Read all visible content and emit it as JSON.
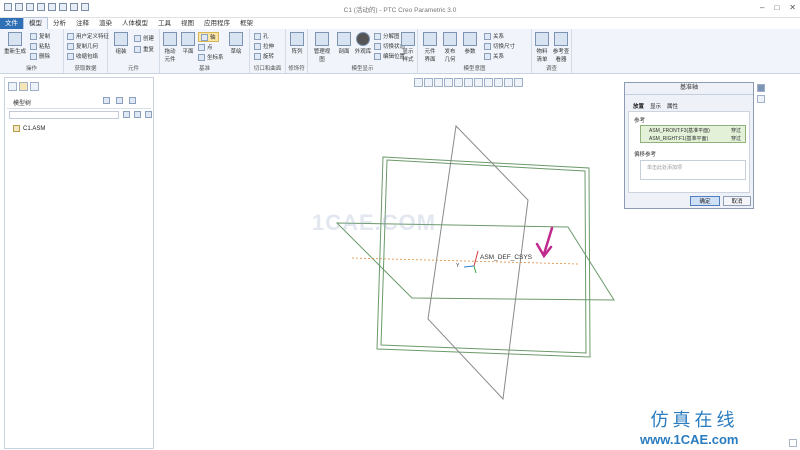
{
  "window": {
    "title": "C1 (活动的) - PTC Creo Parametric 3.0"
  },
  "ribbon_tabs": [
    "文件",
    "模型",
    "分析",
    "注释",
    "渲染",
    "人体模型",
    "工具",
    "视图",
    "应用程序",
    "框架"
  ],
  "active_tab": "模型",
  "ribbon": {
    "operations": {
      "items": [
        "重新生成",
        "复制",
        "粘贴",
        "删除"
      ],
      "label": "操作"
    },
    "get_data": {
      "items": [
        "用户定义特征",
        "复制几何",
        "收缩包络"
      ],
      "label": "获取数据"
    },
    "components": {
      "items": [
        "组装",
        "创建",
        "重复"
      ],
      "label": "元件"
    },
    "datum": {
      "items": [
        "拖动元件",
        "平面",
        "轴",
        "点",
        "坐标系",
        "草绘"
      ],
      "label": "基准"
    },
    "cut_surface": {
      "items": [
        "孔",
        "拉伸",
        "旋转"
      ],
      "label": "切口和曲面"
    },
    "modifiers": {
      "items": [
        "阵列"
      ],
      "label": "修饰符"
    },
    "model_display": {
      "items": [
        "管理视图",
        "剖面",
        "外观库",
        "分解图",
        "切换状态",
        "编辑位置",
        "显示样式"
      ],
      "label": "模型显示"
    },
    "model_intent": {
      "items": [
        "元件界面",
        "发布几何",
        "参数",
        "关系",
        "切换尺寸",
        "关系"
      ],
      "label": "模型意图"
    },
    "investigate": {
      "items": [
        "物料清单",
        "参考查看器"
      ],
      "label": "调查"
    }
  },
  "model_tree": {
    "title": "模型树",
    "items": [
      {
        "label": "C1.ASM",
        "icon": "assembly-icon"
      }
    ]
  },
  "viewport": {
    "coord_sys_label": "ASM_DEF_CSYS",
    "watermark": "1CAE.COM"
  },
  "dialog": {
    "title": "基准轴",
    "tabs": [
      "放置",
      "显示",
      "属性"
    ],
    "active_tab": "放置",
    "references_label": "参考",
    "references": [
      {
        "name": "ASM_FRONT:F3(基准平面)",
        "constraint": "穿过"
      },
      {
        "name": "ASM_RIGHT:F1(基准平面)",
        "constraint": "穿过"
      }
    ],
    "offset_label": "偏移参考",
    "offset_placeholder": "单击此处添加项",
    "ok_label": "确定",
    "cancel_label": "取消"
  },
  "branding": {
    "cn": "仿真在线",
    "url": "www.1CAE.com"
  },
  "colors": {
    "accent": "#2e6fb5",
    "plane": "#6b9a6b",
    "arrow": "#c02a8c",
    "brand": "#2a7cc0"
  }
}
